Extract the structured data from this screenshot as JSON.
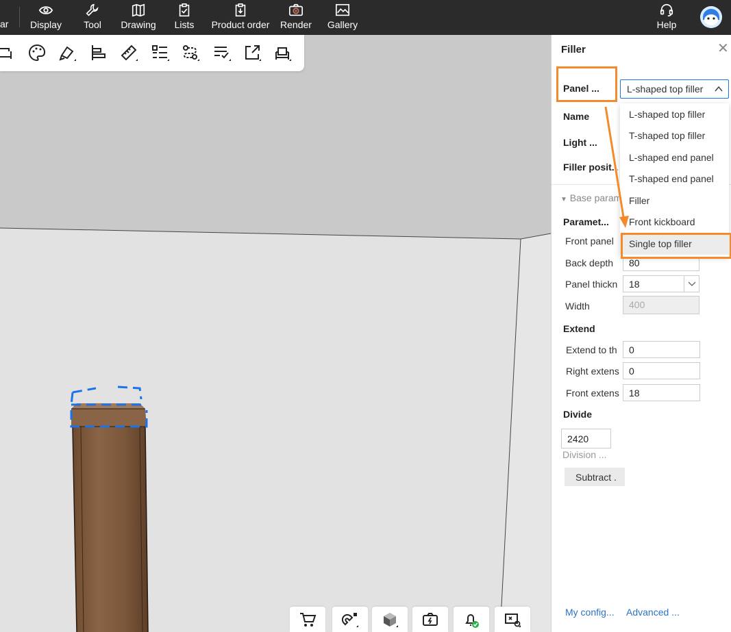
{
  "topbar": {
    "truncated_label": "ar",
    "items": [
      {
        "label": "Display"
      },
      {
        "label": "Tool"
      },
      {
        "label": "Drawing"
      },
      {
        "label": "Lists"
      },
      {
        "label": "Product order"
      },
      {
        "label": "Render"
      },
      {
        "label": "Gallery"
      },
      {
        "label": "Help"
      }
    ]
  },
  "panel": {
    "title": "Filler",
    "panel_type_label": "Panel ...",
    "panel_type_value": "L-shaped top filler",
    "name_label": "Name",
    "light_label": "Light ...",
    "filler_position_label": "Filler posit...",
    "base_params_label": "Base param",
    "parameters_label": "Paramet...",
    "front_panel_label": "Front panel",
    "back_depth_label": "Back depth",
    "back_depth_value": "80",
    "panel_thickness_label": "Panel thickn",
    "panel_thickness_value": "18",
    "width_label": "Width",
    "width_value": "400",
    "extend_label": "Extend",
    "extend_to_label": "Extend to th",
    "extend_to_value": "0",
    "right_extend_label": "Right extens",
    "right_extend_value": "0",
    "front_extend_label": "Front extens",
    "front_extend_value": "18",
    "divide_label": "Divide",
    "divide_value": "2420",
    "division_label": "Division ...",
    "subtract_label": "Subtract .",
    "my_config_link": "My config...",
    "advanced_link": "Advanced ..."
  },
  "dropdown": {
    "options": [
      "L-shaped top filler",
      "T-shaped top filler",
      "L-shaped end panel",
      "T-shaped end panel",
      "Filler",
      "Front kickboard",
      "Single top filler"
    ],
    "highlighted": "Single top filler"
  },
  "colors": {
    "accent": "#1a73e8",
    "highlight": "#f58a2c",
    "wood": "#7a563a"
  }
}
